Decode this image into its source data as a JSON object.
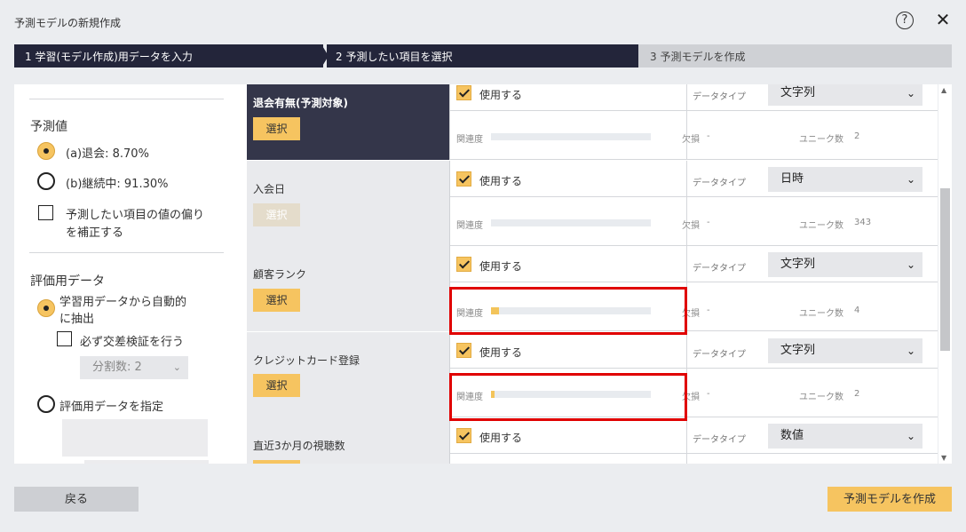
{
  "window": {
    "title": "予測モデルの新規作成",
    "help_icon": "?",
    "close_icon": "✕"
  },
  "steps": [
    {
      "label": "1 学習(モデル作成)用データを入力",
      "state": "done"
    },
    {
      "label": "2 予測したい項目を選択",
      "state": "active"
    },
    {
      "label": "3 予測モデルを作成",
      "state": "pending"
    }
  ],
  "left": {
    "prediction_heading": "予測値",
    "option_a": "(a)退会: 8.70%",
    "option_b": "(b)継続中: 91.30%",
    "correct_bias_line1": "予測したい項目の値の偏り",
    "correct_bias_line2": "を補正する",
    "eval_heading": "評価用データ",
    "auto_extract_line1": "学習用データから自動的",
    "auto_extract_line2": "に抽出",
    "cross_validation": "必ず交差検証を行う",
    "split_count": "分割数: 2",
    "specify_eval": "評価用データを指定"
  },
  "labels": {
    "select": "選択",
    "use": "使用する",
    "data_type": "データタイプ",
    "relevance": "関連度",
    "missing": "欠損",
    "unique_count": "ユニーク数",
    "chevron": "⌄"
  },
  "rows": [
    {
      "name": "退会有無(予測対象)",
      "selected": true,
      "select_enabled": true,
      "data_type": "文字列",
      "missing": "-",
      "unique": "2",
      "relevance": 0
    },
    {
      "name": "入会日",
      "selected": false,
      "select_enabled": false,
      "data_type": "日時",
      "missing": "-",
      "unique": "343",
      "relevance": 0
    },
    {
      "name": "顧客ランク",
      "selected": false,
      "select_enabled": true,
      "data_type": "文字列",
      "missing": "-",
      "unique": "4",
      "relevance": 0.05
    },
    {
      "name": "クレジットカード登録",
      "selected": false,
      "select_enabled": true,
      "data_type": "文字列",
      "missing": "-",
      "unique": "2",
      "relevance": 0.02
    },
    {
      "name": "直近3か月の視聴数",
      "selected": false,
      "select_enabled": true,
      "data_type": "数値",
      "missing": "",
      "unique": "",
      "relevance": 0
    }
  ],
  "footer": {
    "back": "戻る",
    "create": "予測モデルを作成"
  },
  "colors": {
    "accent": "#f6c460",
    "dark": "#23253a",
    "highlight": "#e00000"
  }
}
